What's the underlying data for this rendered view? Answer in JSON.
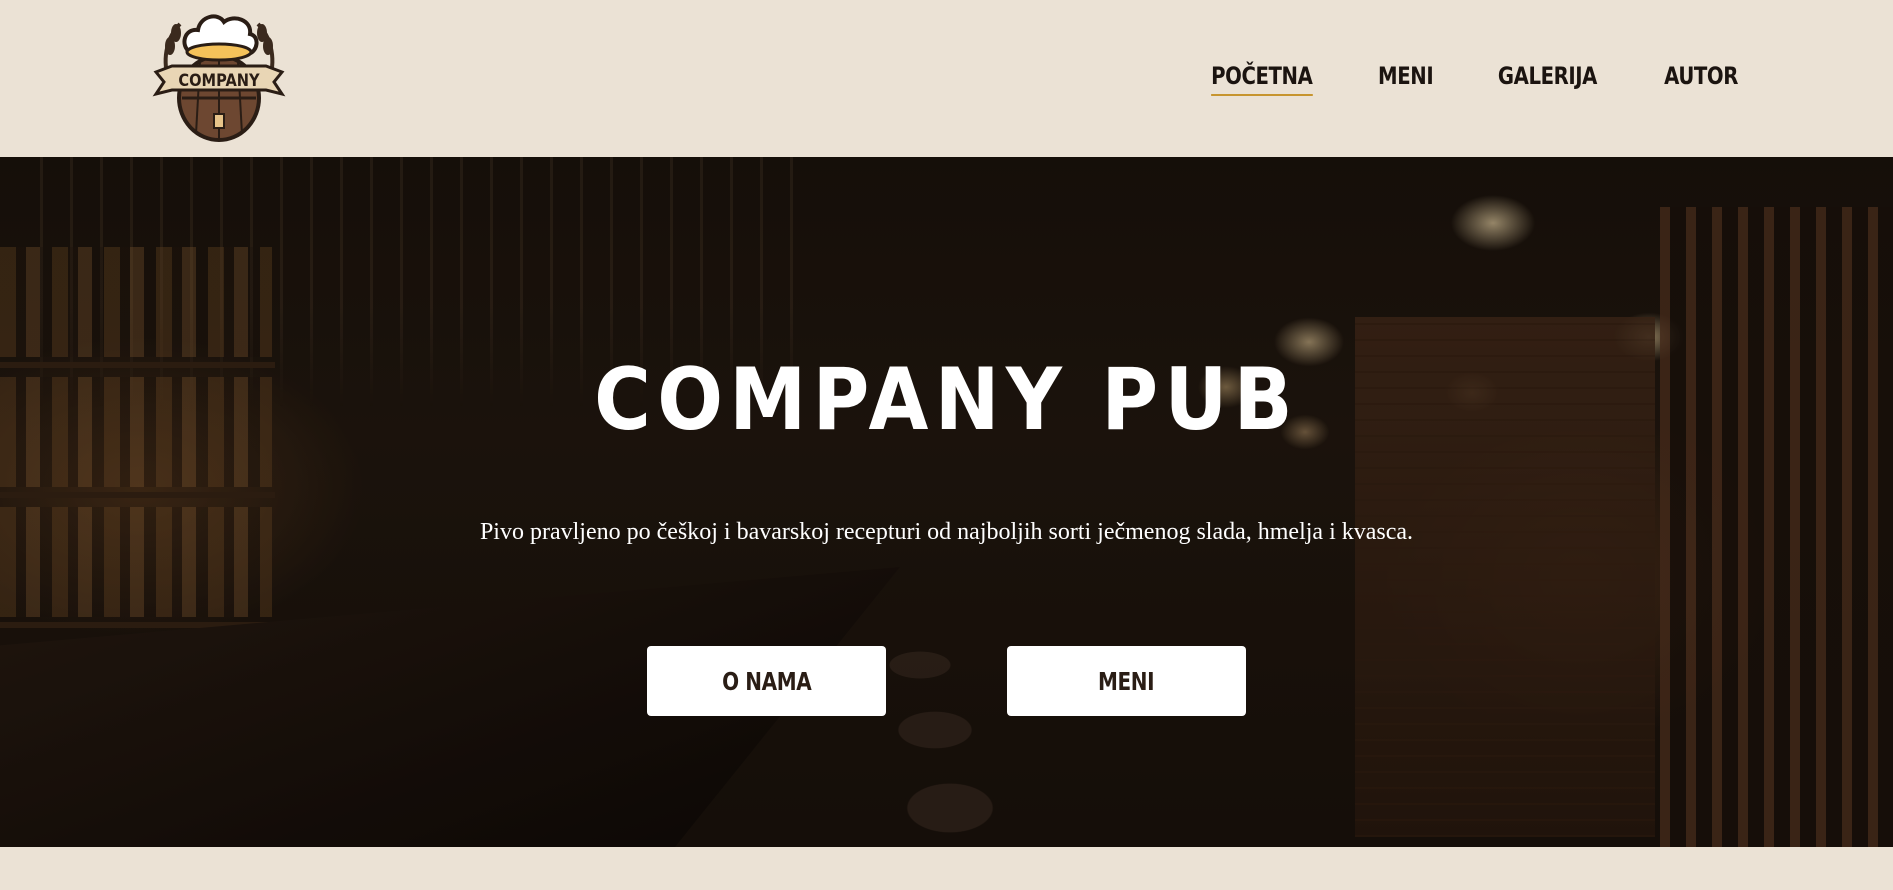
{
  "header": {
    "logo_text": "COMPANY",
    "nav": [
      {
        "label": "POČETNA",
        "active": true
      },
      {
        "label": "MENI",
        "active": false
      },
      {
        "label": "GALERIJA",
        "active": false
      },
      {
        "label": "AUTOR",
        "active": false
      }
    ]
  },
  "hero": {
    "title": "COMPANY PUB",
    "subtitle": "Pivo pravljeno po češkoj i bavarskoj recepturi od najboljih sorti ječmenog slada, hmelja i kvasca.",
    "buttons": [
      {
        "label": "O NAMA"
      },
      {
        "label": "MENI"
      }
    ]
  },
  "colors": {
    "background": "#ebe2d5",
    "nav_active_underline": "#c7952f",
    "text_dark": "#1b1410",
    "button_bg": "#ffffff"
  }
}
